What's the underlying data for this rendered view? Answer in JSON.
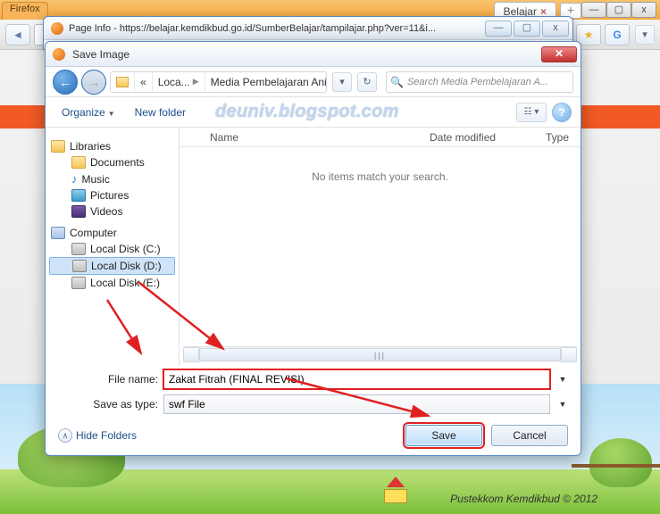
{
  "browser": {
    "firefox_tab": "Firefox",
    "far_tab": "Belajar",
    "back": "◄",
    "url_display": "",
    "win_min": "—",
    "win_max": "▢",
    "win_close": "x"
  },
  "pageinfo": {
    "title": "Page Info - https://belajar.kemdikbud.go.id/SumberBelajar/tampilajar.php?ver=11&i...",
    "min": "—",
    "max": "▢",
    "close": "x"
  },
  "dialog": {
    "title": "Save Image",
    "close": "✕",
    "nav_back": "←",
    "nav_fwd": "→",
    "crumb_pre": "«",
    "crumb1": "Loca...",
    "crumb2": "Media Pembelajaran Anim...",
    "refresh": "↻",
    "search_placeholder": "Search Media Pembelajaran A...",
    "organize": "Organize",
    "organize_arr": "▼",
    "newfolder": "New folder",
    "watermark": "deuniv.blogspot.com",
    "view_btn": "☷ ▾",
    "help": "?",
    "cols": {
      "name": "Name",
      "date": "Date modified",
      "type": "Type"
    },
    "empty": "No items match your search.",
    "scroll_grip": "|||",
    "filename_lbl": "File name:",
    "filename_val": "Zakat Fitrah (FINAL REVISI)",
    "saveas_lbl": "Save as type:",
    "saveas_val": "swf File",
    "combo_arr": "▼",
    "hide_folders": "Hide Folders",
    "hide_chev": "∧",
    "save": "Save",
    "cancel": "Cancel"
  },
  "tree": {
    "libraries": "Libraries",
    "documents": "Documents",
    "music": "Music",
    "pictures": "Pictures",
    "videos": "Videos",
    "computer": "Computer",
    "c": "Local Disk (C:)",
    "d": "Local Disk (D:)",
    "e": "Local Disk (E:)"
  },
  "footer": {
    "copyright": "Pustekkom Kemdikbud © 2012"
  }
}
